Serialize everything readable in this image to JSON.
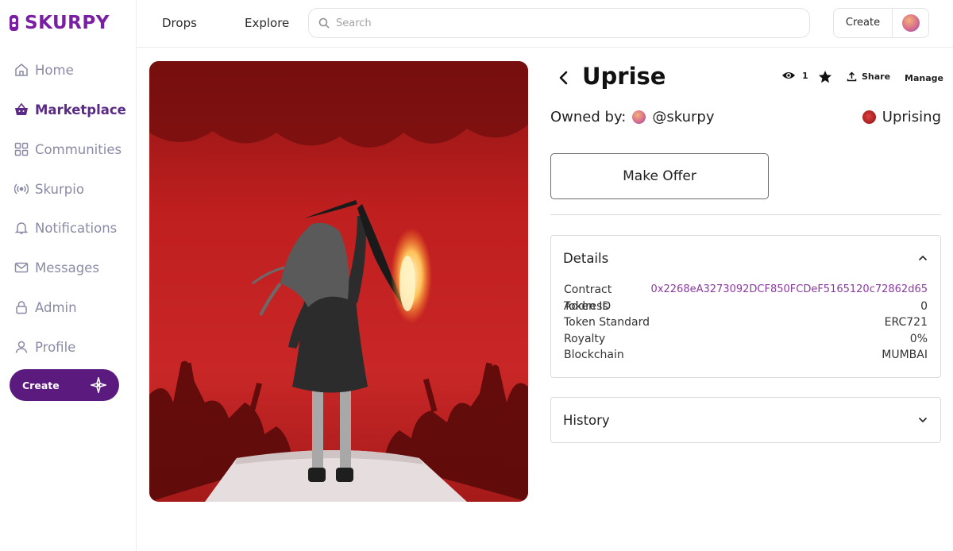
{
  "brand": {
    "name": "SKURPY"
  },
  "sidebar": {
    "items": [
      {
        "label": "Home",
        "icon": "home-icon"
      },
      {
        "label": "Marketplace",
        "icon": "shop-basket-icon",
        "active": true
      },
      {
        "label": "Communities",
        "icon": "grid-icon"
      },
      {
        "label": "Skurpio",
        "icon": "broadcast-icon"
      },
      {
        "label": "Notifications",
        "icon": "bell-icon"
      },
      {
        "label": "Messages",
        "icon": "mail-icon"
      },
      {
        "label": "Admin",
        "icon": "lock-icon"
      },
      {
        "label": "Profile",
        "icon": "user-icon"
      }
    ],
    "create_label": "Create"
  },
  "topbar": {
    "links": [
      "Drops",
      "Explore"
    ],
    "search_placeholder": "Search",
    "create_label": "Create"
  },
  "nft": {
    "title": "Uprise",
    "view_count": "1",
    "share_label": "Share",
    "manage_label": "Manage",
    "owned_by_label": "Owned by:",
    "owner_handle": "@skurpy",
    "collection_name": "Uprising",
    "make_offer_label": "Make Offer"
  },
  "details": {
    "heading": "Details",
    "rows": [
      {
        "label": "Contract Address",
        "value": "0x2268eA3273092DCF850FCDeF5165120c72862d65"
      },
      {
        "label": "Token ID",
        "value": "0"
      },
      {
        "label": "Token Standard",
        "value": "ERC721"
      },
      {
        "label": "Royalty",
        "value": "0%"
      },
      {
        "label": "Blockchain",
        "value": "MUMBAI"
      }
    ]
  },
  "history": {
    "heading": "History"
  },
  "colors": {
    "brand": "#7a1fa2",
    "create_button": "#5b1a7e",
    "link_purple": "#8b3aa0",
    "art_red": "#c22222"
  }
}
